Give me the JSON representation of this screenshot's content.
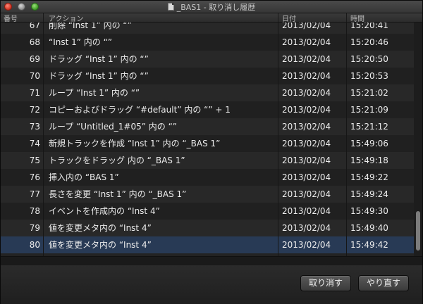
{
  "window": {
    "title": "_BAS1 - 取り消し履歴"
  },
  "table": {
    "headers": {
      "number": "番号",
      "action": "アクション",
      "date": "日付",
      "time": "時間"
    },
    "rows": [
      {
        "number": "67",
        "action": "削除 “Inst 1” 内の “”",
        "date": "2013/02/04",
        "time": "15:20:41"
      },
      {
        "number": "68",
        "action": "“Inst 1” 内の “”",
        "date": "2013/02/04",
        "time": "15:20:46"
      },
      {
        "number": "69",
        "action": "ドラッグ “Inst 1” 内の “”",
        "date": "2013/02/04",
        "time": "15:20:50"
      },
      {
        "number": "70",
        "action": "ドラッグ “Inst 1” 内の “”",
        "date": "2013/02/04",
        "time": "15:20:53"
      },
      {
        "number": "71",
        "action": "ループ “Inst 1” 内の “”",
        "date": "2013/02/04",
        "time": "15:21:02"
      },
      {
        "number": "72",
        "action": "コピーおよびドラッグ “#default” 内の “” + 1",
        "date": "2013/02/04",
        "time": "15:21:09"
      },
      {
        "number": "73",
        "action": "ループ “Untitled_1#05” 内の “”",
        "date": "2013/02/04",
        "time": "15:21:12"
      },
      {
        "number": "74",
        "action": "新規トラックを作成 “Inst 1” 内の “_BAS 1”",
        "date": "2013/02/04",
        "time": "15:49:06"
      },
      {
        "number": "75",
        "action": "トラックをドラッグ 内の “_BAS 1”",
        "date": "2013/02/04",
        "time": "15:49:18"
      },
      {
        "number": "76",
        "action": "挿入内の “BAS 1”",
        "date": "2013/02/04",
        "time": "15:49:22"
      },
      {
        "number": "77",
        "action": "長さを変更 “Inst 1” 内の “_BAS 1”",
        "date": "2013/02/04",
        "time": "15:49:24"
      },
      {
        "number": "78",
        "action": "イベントを作成内の “Inst 4”",
        "date": "2013/02/04",
        "time": "15:49:30"
      },
      {
        "number": "79",
        "action": "値を変更メタ内の “Inst 4”",
        "date": "2013/02/04",
        "time": "15:49:40"
      },
      {
        "number": "80",
        "action": "値を変更メタ内の “Inst 4”",
        "date": "2013/02/04",
        "time": "15:49:42"
      }
    ],
    "selected_row": "80"
  },
  "buttons": {
    "undo": "取り消す",
    "redo": "やり直す"
  },
  "colors": {
    "selection": "#283a55",
    "close": "#d0311f",
    "zoom": "#3c9a22"
  }
}
